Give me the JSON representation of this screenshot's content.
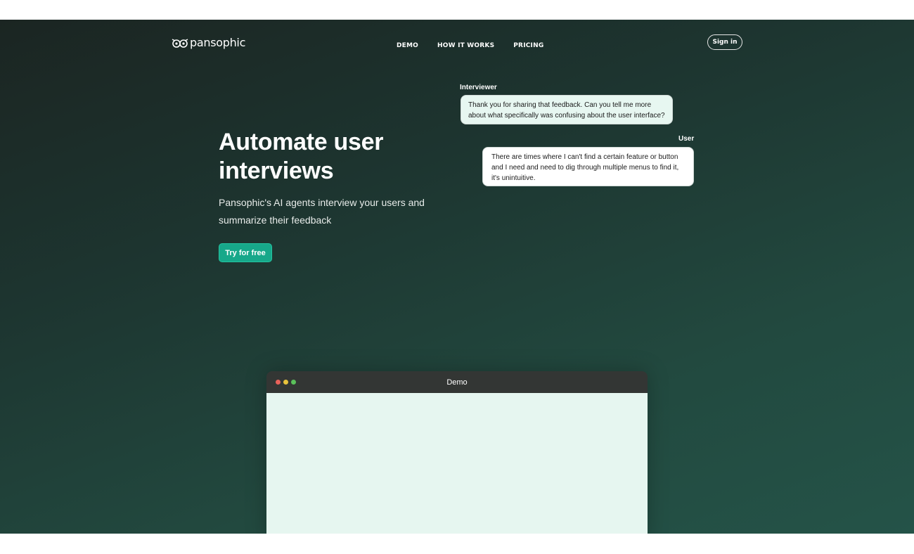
{
  "brand": {
    "name": "pansophic",
    "icon": "owl-eyes-icon"
  },
  "nav": {
    "items": [
      {
        "label": "DEMO"
      },
      {
        "label": "HOW IT WORKS"
      },
      {
        "label": "PRICING"
      }
    ],
    "signin_label": "Sign in"
  },
  "hero": {
    "headline": "Automate user interviews",
    "subline": "Pansophic's AI agents interview your users and summarize their feedback",
    "cta_label": "Try for free"
  },
  "chat": {
    "interviewer_label": "Interviewer",
    "interviewer_message": "Thank you for sharing that feedback. Can you tell me more about what specifically was confusing about the user interface?",
    "user_label": "User",
    "user_message": "There are times where I can't find a certain feature or button and I need and need to dig through multiple menus to find it, it's unintuitive."
  },
  "demo": {
    "title": "Demo",
    "dot_colors": [
      "#e8625a",
      "#e8c33c",
      "#5ac15a"
    ]
  },
  "colors": {
    "accent": "#17a88a",
    "background_dark": "#1b2522",
    "background_green": "#245348",
    "demo_body": "#e6f6f0"
  }
}
